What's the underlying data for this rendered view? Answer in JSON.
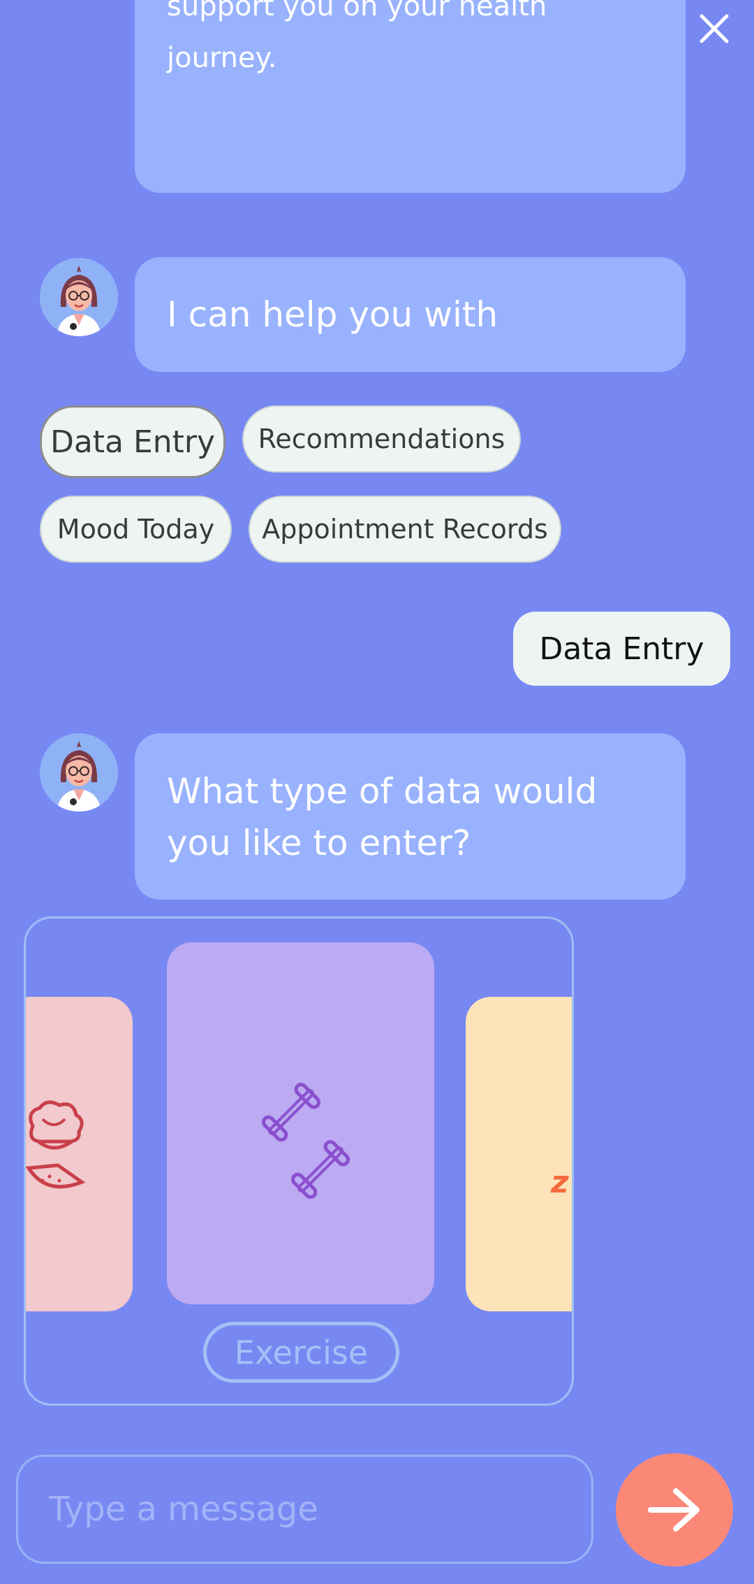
{
  "header": {
    "close_icon": "close-icon"
  },
  "messages": {
    "intro_partial": "support you on your health journey.",
    "help": "I can help you with",
    "user_reply": "Data Entry",
    "question": "What type of data would you like to enter?"
  },
  "options": [
    {
      "label": "Data Entry",
      "selected": true
    },
    {
      "label": "Recommendations",
      "selected": false
    },
    {
      "label": "Mood Today",
      "selected": false
    },
    {
      "label": "Appointment Records",
      "selected": false
    }
  ],
  "carousel": {
    "current_label": "Exercise",
    "cards": [
      {
        "icon": "food-icon",
        "color": "#f2c9cc"
      },
      {
        "icon": "dumbbell-icon",
        "color": "#bcaaf3"
      },
      {
        "icon": "sleep-icon",
        "color": "#fee3b9",
        "glyph": "z"
      }
    ]
  },
  "composer": {
    "placeholder": "Type a message",
    "send_icon": "arrow-right-icon"
  },
  "colors": {
    "background": "#7788f3",
    "bot_bubble": "#98b2fd",
    "chip": "#eef4f2",
    "send": "#fb8877"
  }
}
